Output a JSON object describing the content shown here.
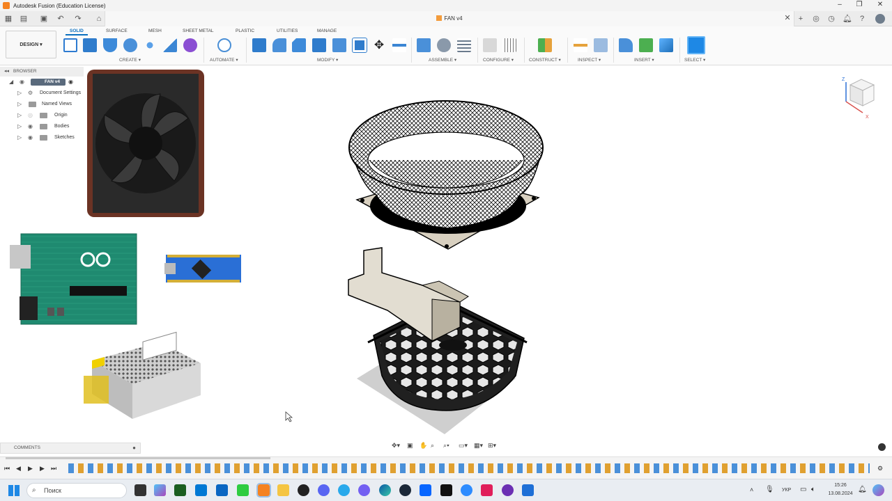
{
  "window": {
    "title": "Autodesk Fusion (Education License)",
    "doc_tab": "FAN v4"
  },
  "ribbon": {
    "workspace": "DESIGN",
    "tabs": [
      "SOLID",
      "SURFACE",
      "MESH",
      "SHEET METAL",
      "PLASTIC",
      "UTILITIES",
      "MANAGE"
    ],
    "groups": [
      "CREATE",
      "AUTOMATE",
      "MODIFY",
      "ASSEMBLE",
      "CONFIGURE",
      "CONSTRUCT",
      "INSPECT",
      "INSERT",
      "SELECT"
    ]
  },
  "browser": {
    "title": "BROWSER",
    "root": "FAN v4",
    "items": [
      "Document Settings",
      "Named Views",
      "Origin",
      "Bodies",
      "Sketches"
    ]
  },
  "comments": {
    "label": "COMMENTS"
  },
  "colors": {
    "accent": "#0a6fbf",
    "fusion_orange": "#f58220",
    "pcb_green": "#1f8a70",
    "nano_blue": "#2a6fd6"
  },
  "taskbar": {
    "search_placeholder": "Поиск",
    "lang": "УКР",
    "time": "15:26",
    "date": "13.08.2024"
  }
}
